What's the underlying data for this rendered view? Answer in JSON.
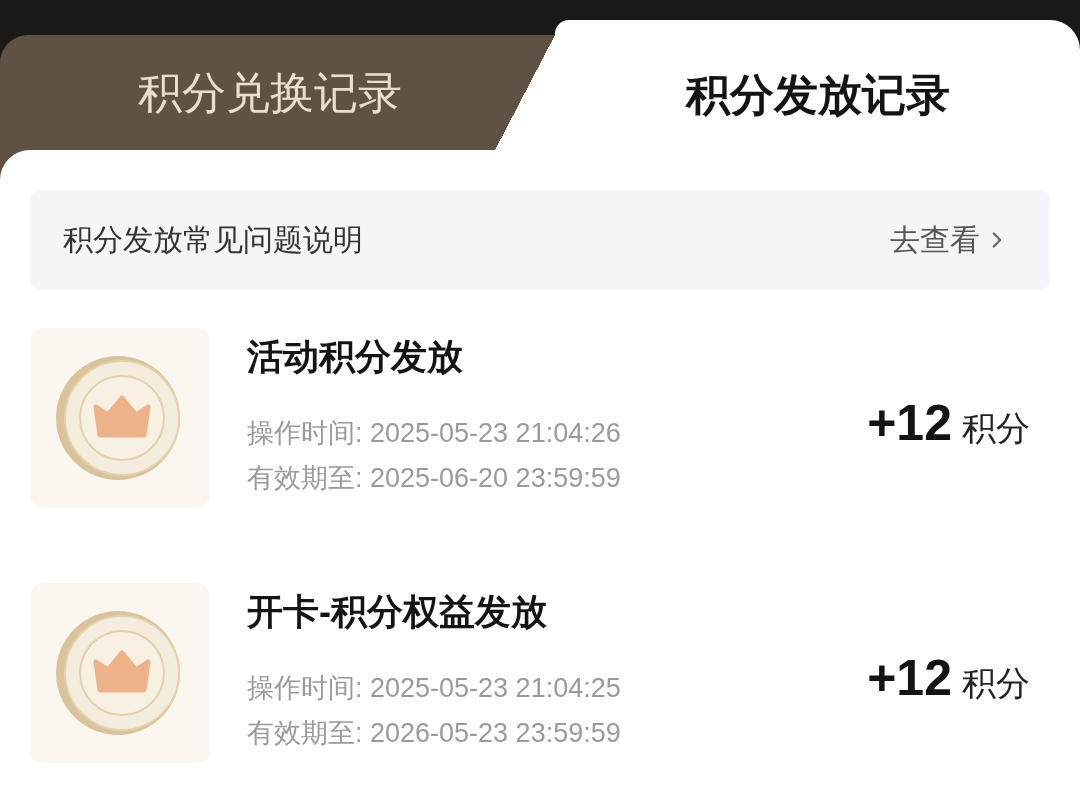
{
  "tabs": [
    {
      "label": "积分兑换记录",
      "selected": false
    },
    {
      "label": "积分发放记录",
      "selected": true
    }
  ],
  "faq_banner": {
    "text": "积分发放常见问题说明",
    "link": "去查看"
  },
  "records": [
    {
      "title": "活动积分发放",
      "operation_time": "操作时间: 2025-05-23 21:04:26",
      "valid_until": "有效期至: 2025-06-20 23:59:59",
      "amount": "+12",
      "unit": "积分"
    },
    {
      "title": "开卡-积分权益发放",
      "operation_time": "操作时间: 2025-05-23 21:04:25",
      "valid_until": "有效期至: 2026-05-23 23:59:59",
      "amount": "+12",
      "unit": "积分"
    }
  ]
}
